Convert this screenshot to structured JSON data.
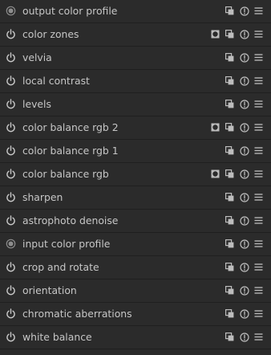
{
  "colors": {
    "background": "#2b2b2b",
    "separator": "#1f1f1f",
    "text": "#c6c6c6",
    "icon": "#bdbdbd"
  },
  "modules": [
    {
      "label": "output color profile",
      "power": "always-on",
      "mask": false
    },
    {
      "label": "color zones",
      "power": "on",
      "mask": true
    },
    {
      "label": "velvia",
      "power": "on",
      "mask": false
    },
    {
      "label": "local contrast",
      "power": "on",
      "mask": false
    },
    {
      "label": "levels",
      "power": "on",
      "mask": false
    },
    {
      "label": "color balance rgb 2",
      "power": "on",
      "mask": true
    },
    {
      "label": "color balance rgb 1",
      "power": "on",
      "mask": false
    },
    {
      "label": "color balance rgb",
      "power": "on",
      "mask": true
    },
    {
      "label": "sharpen",
      "power": "on",
      "mask": false
    },
    {
      "label": "astrophoto denoise",
      "power": "on",
      "mask": false
    },
    {
      "label": "input color profile",
      "power": "always-on",
      "mask": false
    },
    {
      "label": "crop and rotate",
      "power": "on",
      "mask": false
    },
    {
      "label": "orientation",
      "power": "on",
      "mask": false
    },
    {
      "label": "chromatic aberrations",
      "power": "on",
      "mask": false
    },
    {
      "label": "white balance",
      "power": "on",
      "mask": false
    }
  ]
}
